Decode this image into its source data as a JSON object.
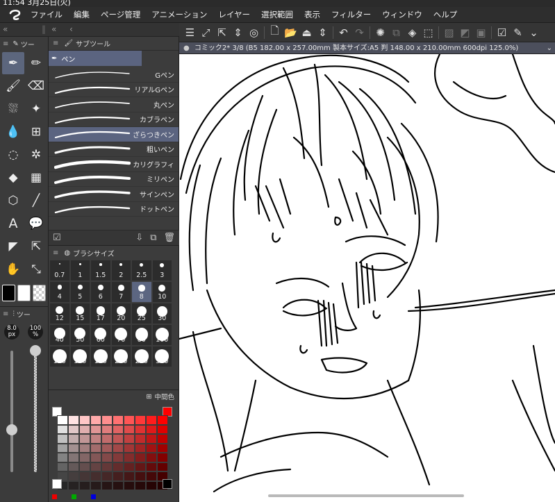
{
  "status": {
    "time": "11:54 3月25日(火)"
  },
  "menu": [
    "ファイル",
    "編集",
    "ページ管理",
    "アニメーション",
    "レイヤー",
    "選択範囲",
    "表示",
    "フィルター",
    "ウィンドウ",
    "ヘルプ"
  ],
  "tool_panel": {
    "title": "ツー"
  },
  "subtool": {
    "title": "サブツール",
    "group": "ペン",
    "items": [
      "Gペン",
      "リアルGペン",
      "丸ペン",
      "カブラペン",
      "ざらつきペン",
      "粗いペン",
      "カリグラフィ",
      "ミリペン",
      "サインペン",
      "ドットペン"
    ],
    "active_index": 4
  },
  "brush_size": {
    "title": "ブラシサイズ",
    "sizes": [
      "0.7",
      "1",
      "1.5",
      "2",
      "2.5",
      "3",
      "4",
      "5",
      "6",
      "7",
      "8",
      "10",
      "12",
      "15",
      "17",
      "20",
      "25",
      "30",
      "40",
      "50",
      "60",
      "70",
      "80",
      "100",
      "120",
      "150",
      "170",
      "200",
      "250",
      "300"
    ],
    "active": "8"
  },
  "tool_property": {
    "title": "ツー",
    "size_value": "8.0",
    "size_unit": "px",
    "opacity_value": "100",
    "opacity_unit": "%",
    "size_level": 0.35,
    "opacity_level": 1.0
  },
  "color_panel": {
    "label": "中間色"
  },
  "document": {
    "tab_title": "コミック2* 3/8 (B5 182.00 x 257.00mm 製本サイズ:A5 判 148.00 x 210.00mm 600dpi 125.0%)"
  },
  "colors": {
    "main": "#000000",
    "sub": "#ffffff",
    "accent": "#ff0000",
    "selection": "#5b6480"
  }
}
